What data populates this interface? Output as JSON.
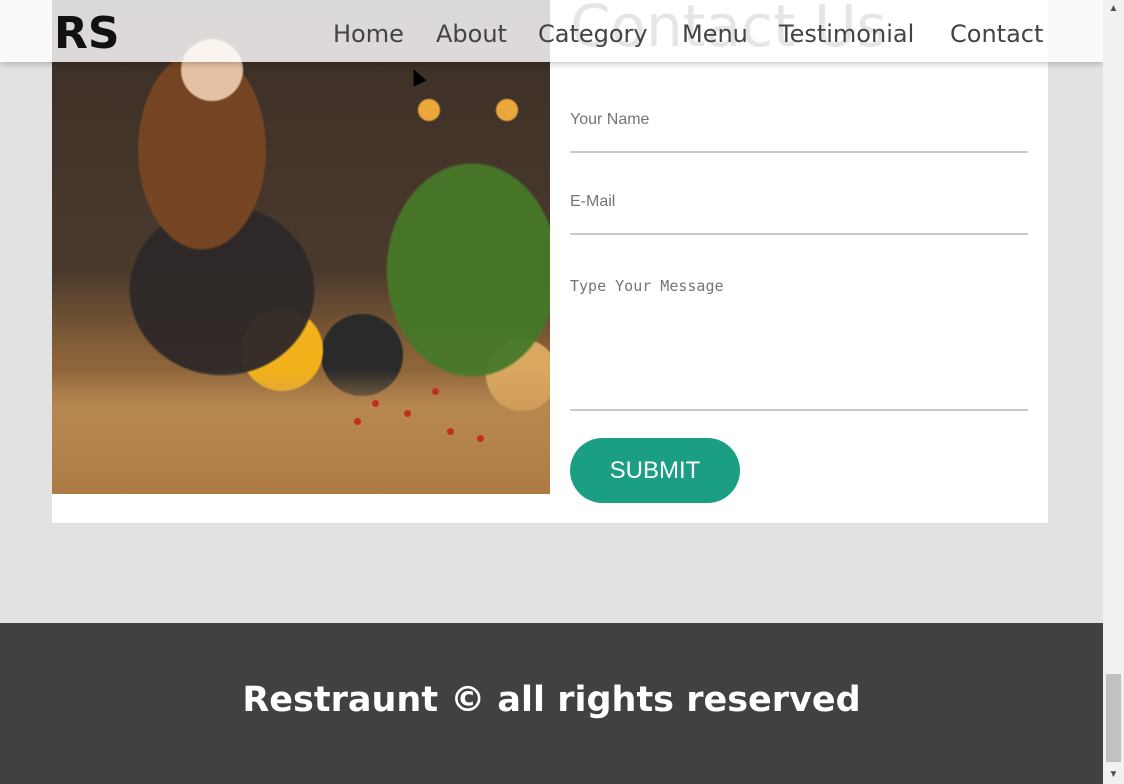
{
  "header": {
    "logo": "RS",
    "section_title": "Contact Us",
    "nav": [
      "Home",
      "About",
      "Category",
      "Menu",
      "Testimonial",
      "Contact"
    ]
  },
  "contact_form": {
    "name_placeholder": "Your Name",
    "email_placeholder": "E-Mail",
    "message_placeholder": "Type Your Message",
    "submit_label": "SUBMIT"
  },
  "footer": {
    "text": "Restraunt © all rights reserved"
  },
  "colors": {
    "accent": "#1a9e84",
    "footer_bg": "#414141",
    "page_bg": "#e2e2e2"
  },
  "icons": {
    "scroll_up": "triangle-up-icon",
    "scroll_down": "triangle-down-icon",
    "cursor": "mouse-pointer-icon"
  }
}
